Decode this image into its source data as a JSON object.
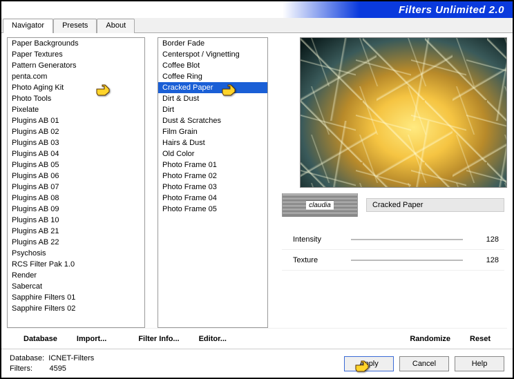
{
  "app": {
    "title": "Filters Unlimited 2.0"
  },
  "tabs": [
    {
      "label": "Navigator",
      "active": true
    },
    {
      "label": "Presets",
      "active": false
    },
    {
      "label": "About",
      "active": false
    }
  ],
  "categories": {
    "selected": "Photo Aging Kit",
    "items": [
      "Paper Backgrounds",
      "Paper Textures",
      "Pattern Generators",
      "penta.com",
      "Photo Aging Kit",
      "Photo Tools",
      "Pixelate",
      "Plugins AB 01",
      "Plugins AB 02",
      "Plugins AB 03",
      "Plugins AB 04",
      "Plugins AB 05",
      "Plugins AB 06",
      "Plugins AB 07",
      "Plugins AB 08",
      "Plugins AB 09",
      "Plugins AB 10",
      "Plugins AB 21",
      "Plugins AB 22",
      "Psychosis",
      "RCS Filter Pak 1.0",
      "Render",
      "Sabercat",
      "Sapphire Filters 01",
      "Sapphire Filters 02"
    ]
  },
  "filters": {
    "selected": "Cracked Paper",
    "items": [
      "Border Fade",
      "Centerspot / Vignetting",
      "Coffee Blot",
      "Coffee Ring",
      "Cracked Paper",
      "Dirt & Dust",
      "Dirt",
      "Dust & Scratches",
      "Film Grain",
      "Hairs & Dust",
      "Old Color",
      "Photo Frame 01",
      "Photo Frame 02",
      "Photo Frame 03",
      "Photo Frame 04",
      "Photo Frame 05"
    ]
  },
  "current_filter": {
    "name": "Cracked Paper",
    "logo_text": "claudia"
  },
  "params": [
    {
      "label": "Intensity",
      "value": "128"
    },
    {
      "label": "Texture",
      "value": "128"
    }
  ],
  "toolbar": {
    "database": "Database",
    "import": "Import...",
    "filter_info": "Filter Info...",
    "editor": "Editor...",
    "randomize": "Randomize",
    "reset": "Reset"
  },
  "status": {
    "db_label": "Database:",
    "db_value": "ICNET-Filters",
    "count_label": "Filters:",
    "count_value": "4595"
  },
  "footer": {
    "apply": "Apply",
    "cancel": "Cancel",
    "help": "Help"
  }
}
